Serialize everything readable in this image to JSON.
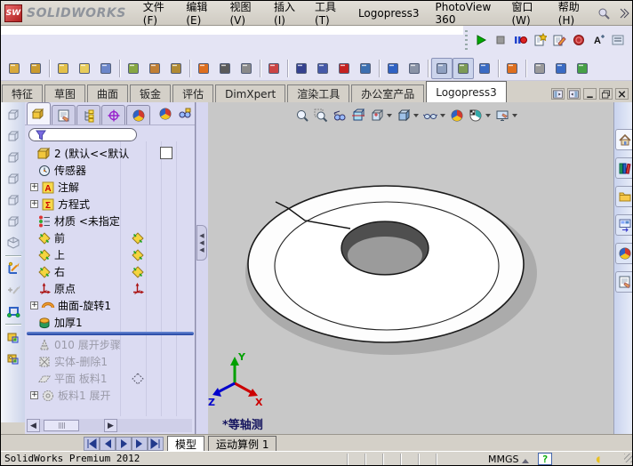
{
  "window": {
    "logo_badge": "SW",
    "logo_text": "SOLIDWORKS"
  },
  "menubar": {
    "items": [
      "文件(F)",
      "编辑(E)",
      "视图(V)",
      "插入(I)",
      "工具(T)",
      "Logopress3",
      "PhotoView 360",
      "窗口(W)",
      "帮助(H)"
    ],
    "right_icons": [
      "search-help-icon",
      "overflow-chevron-icon"
    ]
  },
  "quickbar": {
    "icons": [
      "play-macro-icon",
      "stop-macro-icon",
      "record-pause-macro-icon",
      "new-macro-icon",
      "edit-macro-icon",
      "stamp-icon",
      "scale-text-icon",
      "dock-toolbar-icon"
    ]
  },
  "main_toolbar": {
    "icons": [
      {
        "name": "unfold-tool-icon",
        "color": "#D8A93C"
      },
      {
        "name": "fold-tool-icon",
        "color": "#C99A2E"
      },
      {
        "sep": true
      },
      {
        "name": "flatten-blank-icon",
        "color": "#E3C049"
      },
      {
        "name": "nest-layers-icon",
        "color": "#E8CC5A"
      },
      {
        "name": "bend-tool-icon",
        "color": "#6B86C9"
      },
      {
        "sep": true
      },
      {
        "name": "deburr-spray-icon",
        "color": "#87A743"
      },
      {
        "name": "transfer-step-icon",
        "color": "#C07F35"
      },
      {
        "name": "die-cup-icon",
        "color": "#B08A33"
      },
      {
        "sep": true
      },
      {
        "name": "cone-tool-icon",
        "color": "#DE6F1F"
      },
      {
        "name": "coil-tool-icon",
        "color": "#5A5A5A"
      },
      {
        "name": "forming-tool-icon",
        "color": "#8A8A8A"
      },
      {
        "sep": true
      },
      {
        "name": "flag-tool-icon",
        "color": "#CB4444"
      },
      {
        "sep": true
      },
      {
        "name": "die-set-frame-icon",
        "color": "#35418F"
      },
      {
        "name": "punch-insert-icon",
        "color": "#4559A8"
      },
      {
        "name": "delete-feature-icon",
        "color": "#C42222"
      },
      {
        "name": "strip-grid-icon",
        "color": "#3C6FB0"
      },
      {
        "sep": true
      },
      {
        "name": "sketch-trace-icon",
        "color": "#2F62C4"
      },
      {
        "name": "select-region-icon",
        "color": "#8A93A6"
      },
      {
        "sep": true
      },
      {
        "name": "viewcube-toggle-icon",
        "color": "#8FA0C0",
        "pressed": true
      },
      {
        "name": "probe-toggle-icon",
        "color": "#7C9A55",
        "pressed": true
      },
      {
        "name": "rotate-view-icon",
        "color": "#3A6BC4"
      },
      {
        "sep": true
      },
      {
        "name": "assembly-cone-icon",
        "color": "#DE6F1F"
      },
      {
        "sep": true
      },
      {
        "name": "help-ball-icon",
        "color": "#9A9A9A"
      },
      {
        "name": "user-edit-icon",
        "color": "#3A6BC4"
      },
      {
        "name": "options-table-icon",
        "color": "#46A046"
      }
    ]
  },
  "command_tabs": {
    "items": [
      {
        "label": "特征",
        "active": false
      },
      {
        "label": "草图",
        "active": false
      },
      {
        "label": "曲面",
        "active": false
      },
      {
        "label": "钣金",
        "active": false
      },
      {
        "label": "评估",
        "active": false
      },
      {
        "label": "DimXpert",
        "active": false
      },
      {
        "label": "渲染工具",
        "active": false
      },
      {
        "label": "办公室产品",
        "active": false
      },
      {
        "label": "Logopress3",
        "active": true
      }
    ],
    "window_buttons": [
      "expand-left-pane-icon",
      "expand-right-pane-icon",
      "minimize-icon",
      "restore-icon",
      "close-icon"
    ]
  },
  "left_toolbar": {
    "icons": [
      "view-front-icon",
      "view-back-icon",
      "view-left-icon",
      "view-right-icon",
      "view-top-icon",
      "view-bottom-icon",
      "view-iso-icon",
      "sep",
      "sketch-icon",
      "edit-sketch-ghost-icon",
      "convert-entities-icon",
      "sep",
      "lp-blank-icon",
      "lp-tool-icon"
    ]
  },
  "feature_panel": {
    "tabs": [
      {
        "name": "featuremanager-tab-icon",
        "active": true
      },
      {
        "name": "propertymanager-tab-icon",
        "active": false
      },
      {
        "name": "configurationmanager-tab-icon",
        "active": false
      },
      {
        "name": "dimxpertmanager-tab-icon",
        "active": false
      },
      {
        "name": "displaymanager-tab-icon",
        "active": false
      }
    ],
    "extra_icons": [
      "appearances-ball-icon",
      "hidden-items-icon"
    ],
    "filter": {
      "value": "",
      "placeholder": ""
    },
    "expander_glyph": "+",
    "tree": [
      {
        "icon": "part-icon",
        "label": "2  (默认<<默认",
        "swatch": true,
        "root": true
      },
      {
        "icon": "sensors-icon",
        "label": "传感器"
      },
      {
        "icon": "annotations-icon",
        "label": "注解",
        "expand": true
      },
      {
        "icon": "equations-icon",
        "label": "方程式",
        "expand": true
      },
      {
        "icon": "material-icon",
        "label": "材质 <未指定"
      },
      {
        "icon": "plane-icon",
        "label": "前",
        "mirror": "plane-icon"
      },
      {
        "icon": "plane-icon",
        "label": "上",
        "mirror": "plane-icon"
      },
      {
        "icon": "plane-icon",
        "label": "右",
        "mirror": "plane-icon"
      },
      {
        "icon": "origin-icon",
        "label": "原点",
        "mirror": "origin-icon"
      },
      {
        "icon": "surface-revolve-icon",
        "label": "曲面-旋转1",
        "expand": true
      },
      {
        "icon": "thicken-icon",
        "label": "加厚1"
      },
      {
        "rollback": true
      },
      {
        "icon": "unfold-step-ghost-icon",
        "label": "010 展开步骤",
        "grayed": true
      },
      {
        "icon": "body-delete-ghost-icon",
        "label": "实体-删除1",
        "grayed": true
      },
      {
        "icon": "plane-ghost-icon",
        "label": "平面 板料1",
        "grayed": true,
        "mirror": "plane-outline-icon"
      },
      {
        "icon": "flatten-ghost-icon",
        "label": "板料1 展开",
        "grayed": true,
        "expand": true
      }
    ]
  },
  "viewport": {
    "headsup_icons": [
      {
        "name": "zoom-fit-icon"
      },
      {
        "name": "zoom-area-icon"
      },
      {
        "name": "previous-view-icon"
      },
      {
        "name": "section-view-icon"
      },
      {
        "name": "view-orientation-icon",
        "caret": true
      },
      {
        "name": "display-style-icon",
        "caret": true
      },
      {
        "name": "hide-show-items-icon",
        "caret": true
      },
      {
        "name": "edit-appearance-icon"
      },
      {
        "name": "apply-scene-icon",
        "caret": true
      },
      {
        "name": "view-settings-icon",
        "caret": true
      }
    ],
    "view_label": "*等轴测",
    "triad": {
      "x": "X",
      "y": "Y",
      "z": "Z"
    },
    "triad_colors": {
      "x": "#cc0000",
      "y": "#00a000",
      "z": "#0000cc"
    }
  },
  "task_pane": {
    "icons": [
      "home-icon",
      "design-library-icon",
      "file-explorer-icon",
      "view-palette-icon",
      "appearances-icon",
      "custom-properties-icon"
    ]
  },
  "bottom_bar": {
    "nav_icons": [
      "goto-start-icon",
      "step-back-icon",
      "nav-play-icon",
      "step-forward-icon",
      "goto-end-icon"
    ],
    "tabs": [
      {
        "label": "模型",
        "active": true
      },
      {
        "label": "运动算例 1",
        "active": false
      }
    ]
  },
  "status_bar": {
    "left_text": "SolidWorks Premium 2012",
    "units": "MMGS",
    "icons": [
      "units-dropdown-caret",
      "quick-tips-help-icon",
      "resources-moon-icon"
    ]
  },
  "colors": {
    "toolbar_lavender": "#E4E4F4",
    "panel_lavender": "#DBDBF2",
    "viewport_gray": "#C8C8C8",
    "chrome_gray": "#D4D0C8",
    "statusbar_teal": "#00a0a0",
    "rollback_blue": "#1d3f9e"
  }
}
